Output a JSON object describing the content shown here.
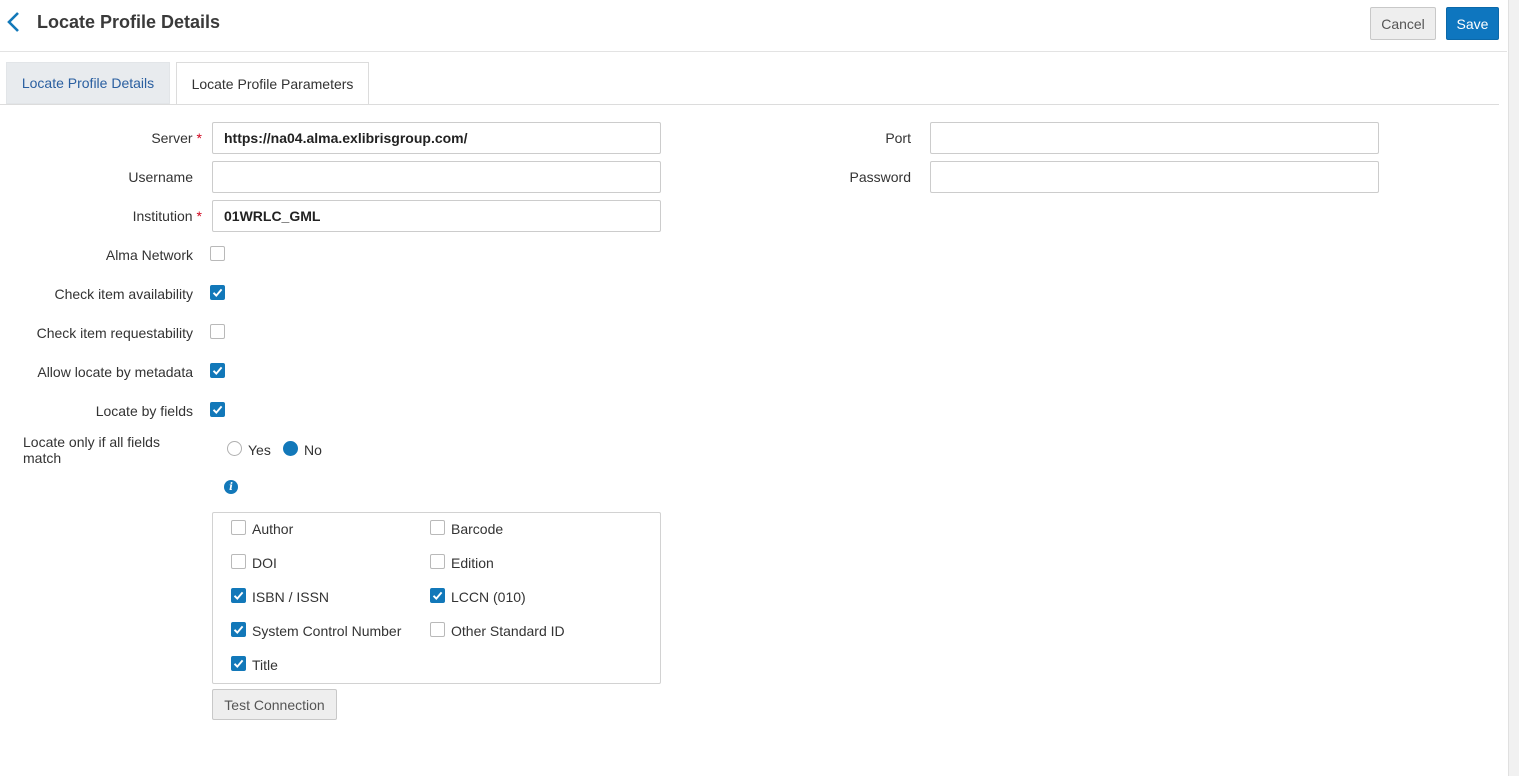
{
  "header": {
    "title": "Locate Profile Details",
    "cancel_label": "Cancel",
    "save_label": "Save"
  },
  "tabs": [
    {
      "label": "Locate Profile Details",
      "active": false
    },
    {
      "label": "Locate Profile Parameters",
      "active": true
    }
  ],
  "form": {
    "server": {
      "label": "Server",
      "required": "*",
      "value": "https://na04.alma.exlibrisgroup.com/"
    },
    "port": {
      "label": "Port",
      "value": ""
    },
    "username": {
      "label": "Username",
      "value": ""
    },
    "password": {
      "label": "Password",
      "value": ""
    },
    "institution": {
      "label": "Institution",
      "required": "*",
      "value": "01WRLC_GML"
    },
    "alma_network": {
      "label": "Alma Network",
      "checked": false
    },
    "check_item_availability": {
      "label": "Check item availability",
      "checked": true
    },
    "check_item_requestability": {
      "label": "Check item requestability",
      "checked": false
    },
    "allow_locate_by_metadata": {
      "label": "Allow locate by metadata",
      "checked": true
    },
    "locate_by_fields": {
      "label": "Locate by fields",
      "checked": true
    },
    "locate_only_if_all_match": {
      "label_line1": "Locate only if all fields",
      "label_line2": "match",
      "options": [
        "Yes",
        "No"
      ],
      "selected": "No"
    },
    "info_icon": "info-icon"
  },
  "fields": {
    "author": {
      "label": "Author",
      "checked": false
    },
    "barcode": {
      "label": "Barcode",
      "checked": false
    },
    "doi": {
      "label": "DOI",
      "checked": false
    },
    "edition": {
      "label": "Edition",
      "checked": false
    },
    "isbn_issn": {
      "label": "ISBN / ISSN",
      "checked": true
    },
    "lccn": {
      "label": "LCCN (010)",
      "checked": true
    },
    "system_control_number": {
      "label": "System Control Number",
      "checked": true
    },
    "other_standard_id": {
      "label": "Other Standard ID",
      "checked": false
    },
    "title": {
      "label": "Title",
      "checked": true
    }
  },
  "test_connection_label": "Test Connection",
  "colors": {
    "accent": "#1278b9",
    "save_button": "#0e76bf",
    "required": "#d0021b",
    "tab_link": "#2a5fa0"
  }
}
